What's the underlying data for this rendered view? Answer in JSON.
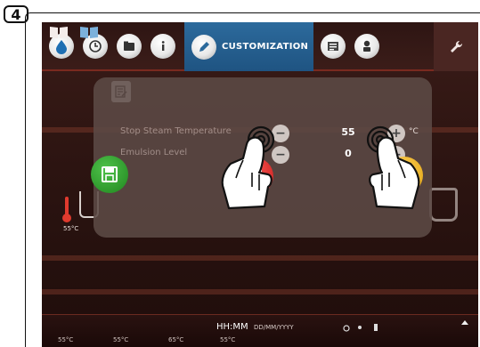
{
  "step_number": "4",
  "nav": {
    "items": [
      {
        "name": "water-drop-icon"
      },
      {
        "name": "clock-icon"
      },
      {
        "name": "folder-icon"
      },
      {
        "name": "info-icon"
      },
      {
        "name": "pencil-icon",
        "label": "CUSTOMIZATION"
      },
      {
        "name": "list-icon"
      },
      {
        "name": "chef-icon"
      },
      {
        "name": "wrench-icon"
      }
    ],
    "active_label": "CUSTOMIZATION",
    "active_color": "#2c6a9c"
  },
  "dialog": {
    "rows": [
      {
        "label": "Stop Steam Temperature",
        "value": "55",
        "unit": "°C"
      },
      {
        "label": "Emulsion Level",
        "value": "0",
        "unit": ""
      }
    ]
  },
  "left_temp": "55°C",
  "statusbar": {
    "time": "HH:MM",
    "date": "DD/MM/YYYY",
    "temps": [
      "55°C",
      "55°C",
      "65°C",
      "55°C"
    ]
  },
  "colors": {
    "save": "#20861f",
    "cancel": "#c51b1b",
    "start": "#e0a10f"
  }
}
